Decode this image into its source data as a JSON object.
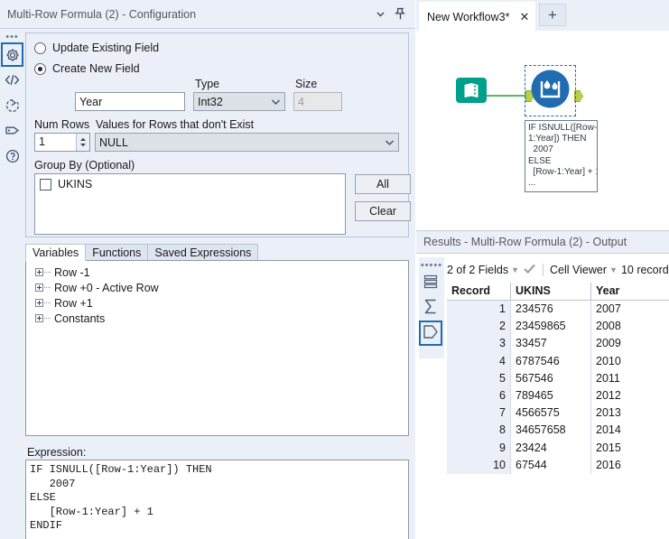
{
  "config": {
    "title": "Multi-Row Formula (2) - Configuration",
    "collapse_icon": "chevron-down-icon",
    "pin_icon": "pin-icon",
    "rail": [
      {
        "icon": "gear-icon",
        "selected": true
      },
      {
        "icon": "code-brackets-icon",
        "selected": false
      },
      {
        "icon": "arrow-circle-icon",
        "selected": false
      },
      {
        "icon": "tag-icon",
        "selected": false
      },
      {
        "icon": "question-circle-icon",
        "selected": false
      }
    ],
    "update_existing_label": "Update Existing Field",
    "create_new_label": "Create New  Field",
    "field_name_value": "Year",
    "type_label": "Type",
    "type_value": "Int32",
    "size_label": "Size",
    "size_value": "4",
    "num_rows_label": "Num Rows",
    "num_rows_value": "1",
    "values_missing_label": "Values for Rows that don't Exist",
    "values_missing_value": "NULL",
    "group_by_label": "Group By (Optional)",
    "group_by_items": [
      {
        "label": "UKINS",
        "checked": false
      }
    ],
    "all_button": "All",
    "clear_button": "Clear"
  },
  "tabs": [
    {
      "label": "Variables",
      "active": true
    },
    {
      "label": "Functions",
      "active": false
    },
    {
      "label": "Saved Expressions",
      "active": false
    }
  ],
  "variables_tree": [
    {
      "label": "Row -1"
    },
    {
      "label": "Row +0 - Active Row"
    },
    {
      "label": "Row +1"
    },
    {
      "label": "Constants"
    }
  ],
  "expression": {
    "label": "Expression:",
    "text": "IF ISNULL([Row-1:Year]) THEN\n   2007\nELSE\n   [Row-1:Year] + 1\nENDIF"
  },
  "workflow": {
    "tab_label": "New Workflow3*",
    "tab_close_icon": "close-icon",
    "new_tab_icon": "plus-icon",
    "nodes": [
      {
        "name": "input-data-tool",
        "icon": "book-icon",
        "color": "#00a08b"
      },
      {
        "name": "multi-row-formula-tool",
        "icon": "water-droplet-icon",
        "color": "#1f6cb0",
        "selected": true
      }
    ],
    "annotation_text": "IF ISNULL([Row-\n1:Year]) THEN\n  2007\nELSE\n  [Row-1:Year] + 1\n..."
  },
  "results": {
    "title": "Results - Multi-Row Formula (2) - Output",
    "rail": [
      {
        "icon": "data-grid-icon",
        "selected": false
      },
      {
        "icon": "sigma-profile-icon",
        "selected": false
      },
      {
        "icon": "pentagon-tag-icon",
        "selected": true
      }
    ],
    "fields_selector": "2 of 2 Fields",
    "check_icon": "check-icon",
    "cell_viewer": "Cell Viewer",
    "record_count": "10 record",
    "columns": [
      "Record",
      "UKINS",
      "Year"
    ],
    "rows": [
      [
        "1",
        "234576",
        "2007"
      ],
      [
        "2",
        "23459865",
        "2008"
      ],
      [
        "3",
        "33457",
        "2009"
      ],
      [
        "4",
        "6787546",
        "2010"
      ],
      [
        "5",
        "567546",
        "2011"
      ],
      [
        "6",
        "789465",
        "2012"
      ],
      [
        "7",
        "4566575",
        "2013"
      ],
      [
        "8",
        "34657658",
        "2014"
      ],
      [
        "9",
        "23424",
        "2015"
      ],
      [
        "10",
        "67544",
        "2016"
      ]
    ]
  },
  "colors": {
    "panel_bg": "#eaeff8",
    "accent_blue": "#1f6cb0",
    "tool_teal": "#00a08b",
    "connector_green": "#5cb85c"
  }
}
